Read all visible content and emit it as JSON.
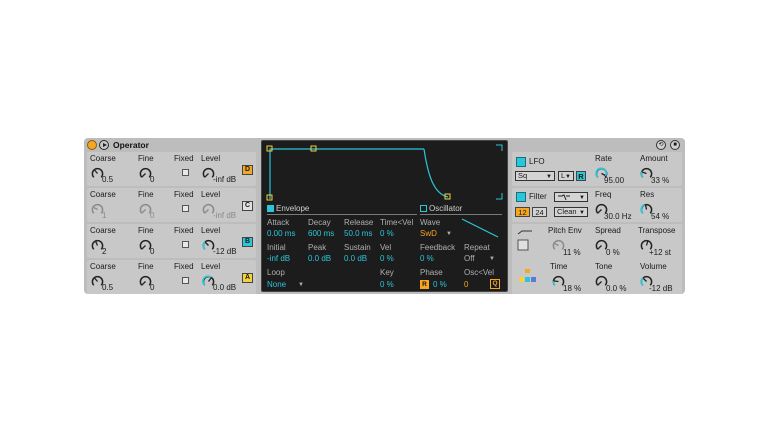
{
  "device": {
    "title": "Operator",
    "power_color": "#f5a623",
    "accent": "#2ac6d9"
  },
  "operators": [
    {
      "coarse_label": "Coarse",
      "coarse": "0.5",
      "fine_label": "Fine",
      "fine": "0",
      "fixed_label": "Fixed",
      "level_label": "Level",
      "level": "-inf dB",
      "osc": "D",
      "osc_active": true
    },
    {
      "coarse_label": "Coarse",
      "coarse": "1",
      "fine_label": "Fine",
      "fine": "0",
      "fixed_label": "Fixed",
      "level_label": "Level",
      "level": "-inf dB",
      "osc": "C",
      "osc_active": false
    },
    {
      "coarse_label": "Coarse",
      "coarse": "2",
      "fine_label": "Fine",
      "fine": "0",
      "fixed_label": "Fixed",
      "level_label": "Level",
      "level": "-12 dB",
      "osc": "B",
      "osc_active": true
    },
    {
      "coarse_label": "Coarse",
      "coarse": "0.5",
      "fine_label": "Fine",
      "fine": "0",
      "fixed_label": "Fixed",
      "level_label": "Level",
      "level": "0.0 dB",
      "osc": "A",
      "osc_active": true
    }
  ],
  "display": {
    "envelope": {
      "title": "Envelope",
      "attack_label": "Attack",
      "attack": "0.00 ms",
      "decay_label": "Decay",
      "decay": "600 ms",
      "release_label": "Release",
      "release": "50.0 ms",
      "timevel_label": "Time<Vel",
      "timevel": "0 %",
      "initial_label": "Initial",
      "initial": "-inf dB",
      "peak_label": "Peak",
      "peak": "0.0 dB",
      "sustain_label": "Sustain",
      "sustain": "0.0 dB",
      "vel_label": "Vel",
      "vel": "0 %",
      "loop_label": "Loop",
      "loop": "None",
      "key_label": "Key",
      "key": "0 %"
    },
    "oscillator": {
      "title": "Oscillator",
      "wave_label": "Wave",
      "wave": "SwD",
      "feedback_label": "Feedback",
      "feedback": "0 %",
      "repeat_label": "Repeat",
      "repeat": "Off",
      "phase_label": "Phase",
      "phase_btn": "R",
      "phase": "0 %",
      "oscvel_label": "Osc<Vel",
      "oscvel": "0",
      "q_btn": "Q"
    }
  },
  "lfo": {
    "title": "LFO",
    "wave": "Sq",
    "range": "L",
    "retrig": "R",
    "rate_label": "Rate",
    "rate": "95.00",
    "amount_label": "Amount",
    "amount": "33 %"
  },
  "filter": {
    "title": "Filter",
    "slope_a": "12",
    "slope_b": "24",
    "circuit": "Clean",
    "freq_label": "Freq",
    "freq": "30.0 Hz",
    "res_label": "Res",
    "res": "54 %"
  },
  "pitch": {
    "pitch_env_label": "Pitch Env",
    "pitch_env": "11 %",
    "spread_label": "Spread",
    "spread": "0 %",
    "transpose_label": "Transpose",
    "transpose": "+12 st"
  },
  "global": {
    "time_label": "Time",
    "time": "18 %",
    "tone_label": "Tone",
    "tone": "0.0 %",
    "volume_label": "Volume",
    "volume": "-12 dB"
  }
}
